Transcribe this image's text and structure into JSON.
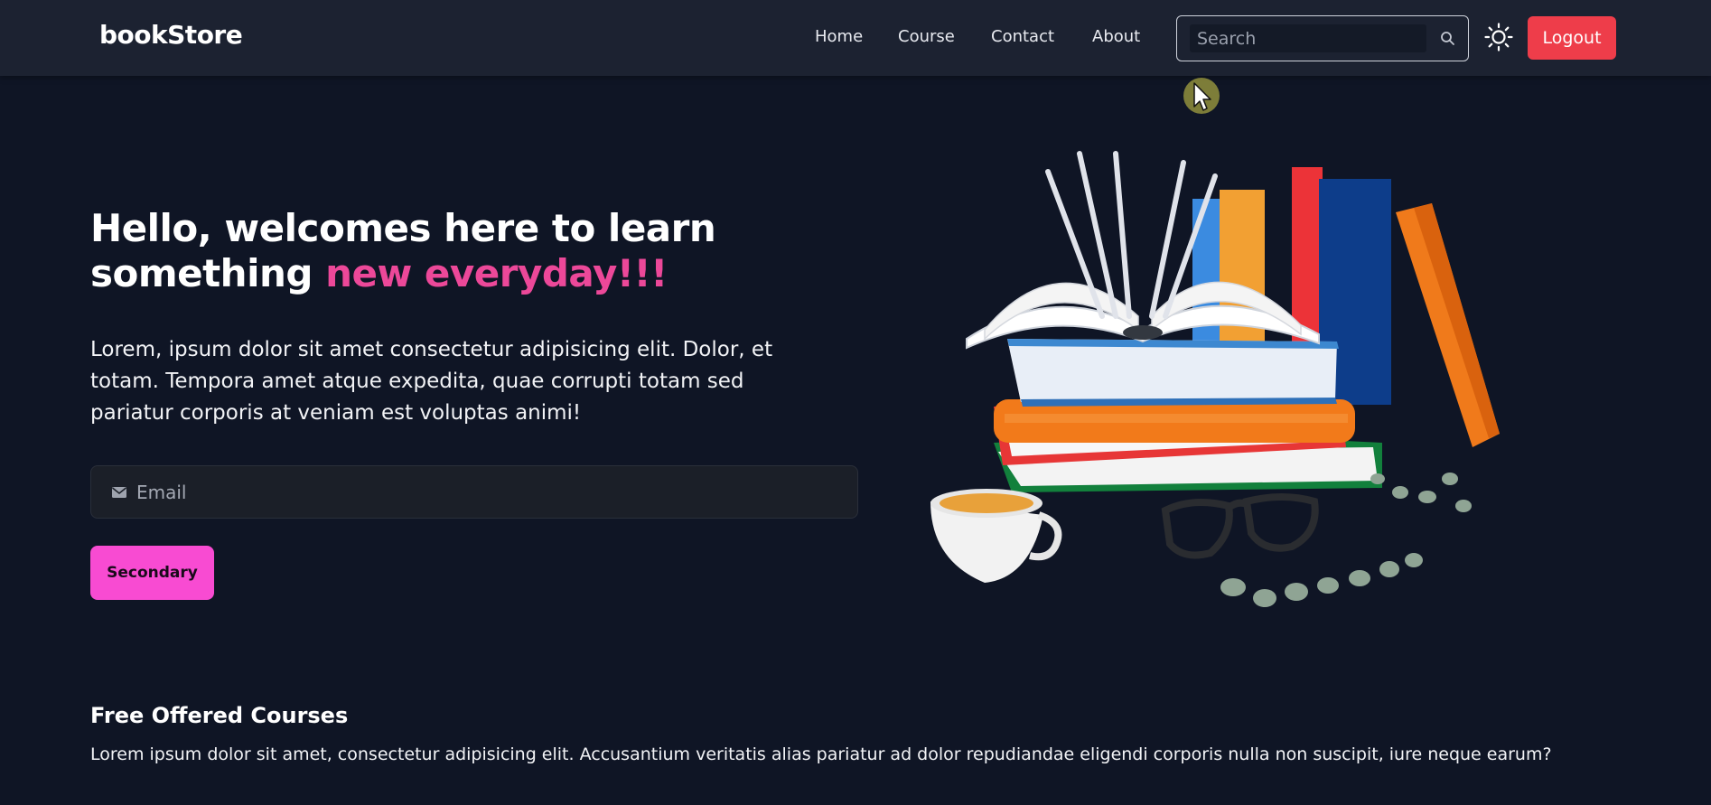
{
  "navbar": {
    "logo": "bookStore",
    "links": [
      {
        "label": "Home"
      },
      {
        "label": "Course"
      },
      {
        "label": "Contact"
      },
      {
        "label": "About"
      }
    ],
    "search": {
      "placeholder": "Search",
      "value": ""
    },
    "logout_label": "Logout"
  },
  "hero": {
    "title_part1": "Hello, welcomes here to learn something ",
    "title_accent": "new everyday!!!",
    "description": "Lorem, ipsum dolor sit amet consectetur adipisicing elit. Dolor, et totam. Tempora amet atque expedita, quae corrupti totam sed pariatur corporis at veniam est voluptas animi!",
    "email_placeholder": "Email",
    "button_label": "Secondary"
  },
  "courses": {
    "title": "Free Offered Courses",
    "description": "Lorem ipsum dolor sit amet, consectetur adipisicing elit. Accusantium veritatis alias pariatur ad dolor repudiandae eligendi corporis nulla non suscipit, iure neque earum?"
  },
  "colors": {
    "background": "#0f1525",
    "navbar": "#1c2231",
    "accent_pink": "#ec4899",
    "logout_red": "#ee3d4a",
    "button_pink": "#f84bd2"
  },
  "icons": {
    "search": "search-icon",
    "theme": "sun-icon",
    "email": "mail-icon",
    "cursor": "mouse-cursor-icon"
  }
}
